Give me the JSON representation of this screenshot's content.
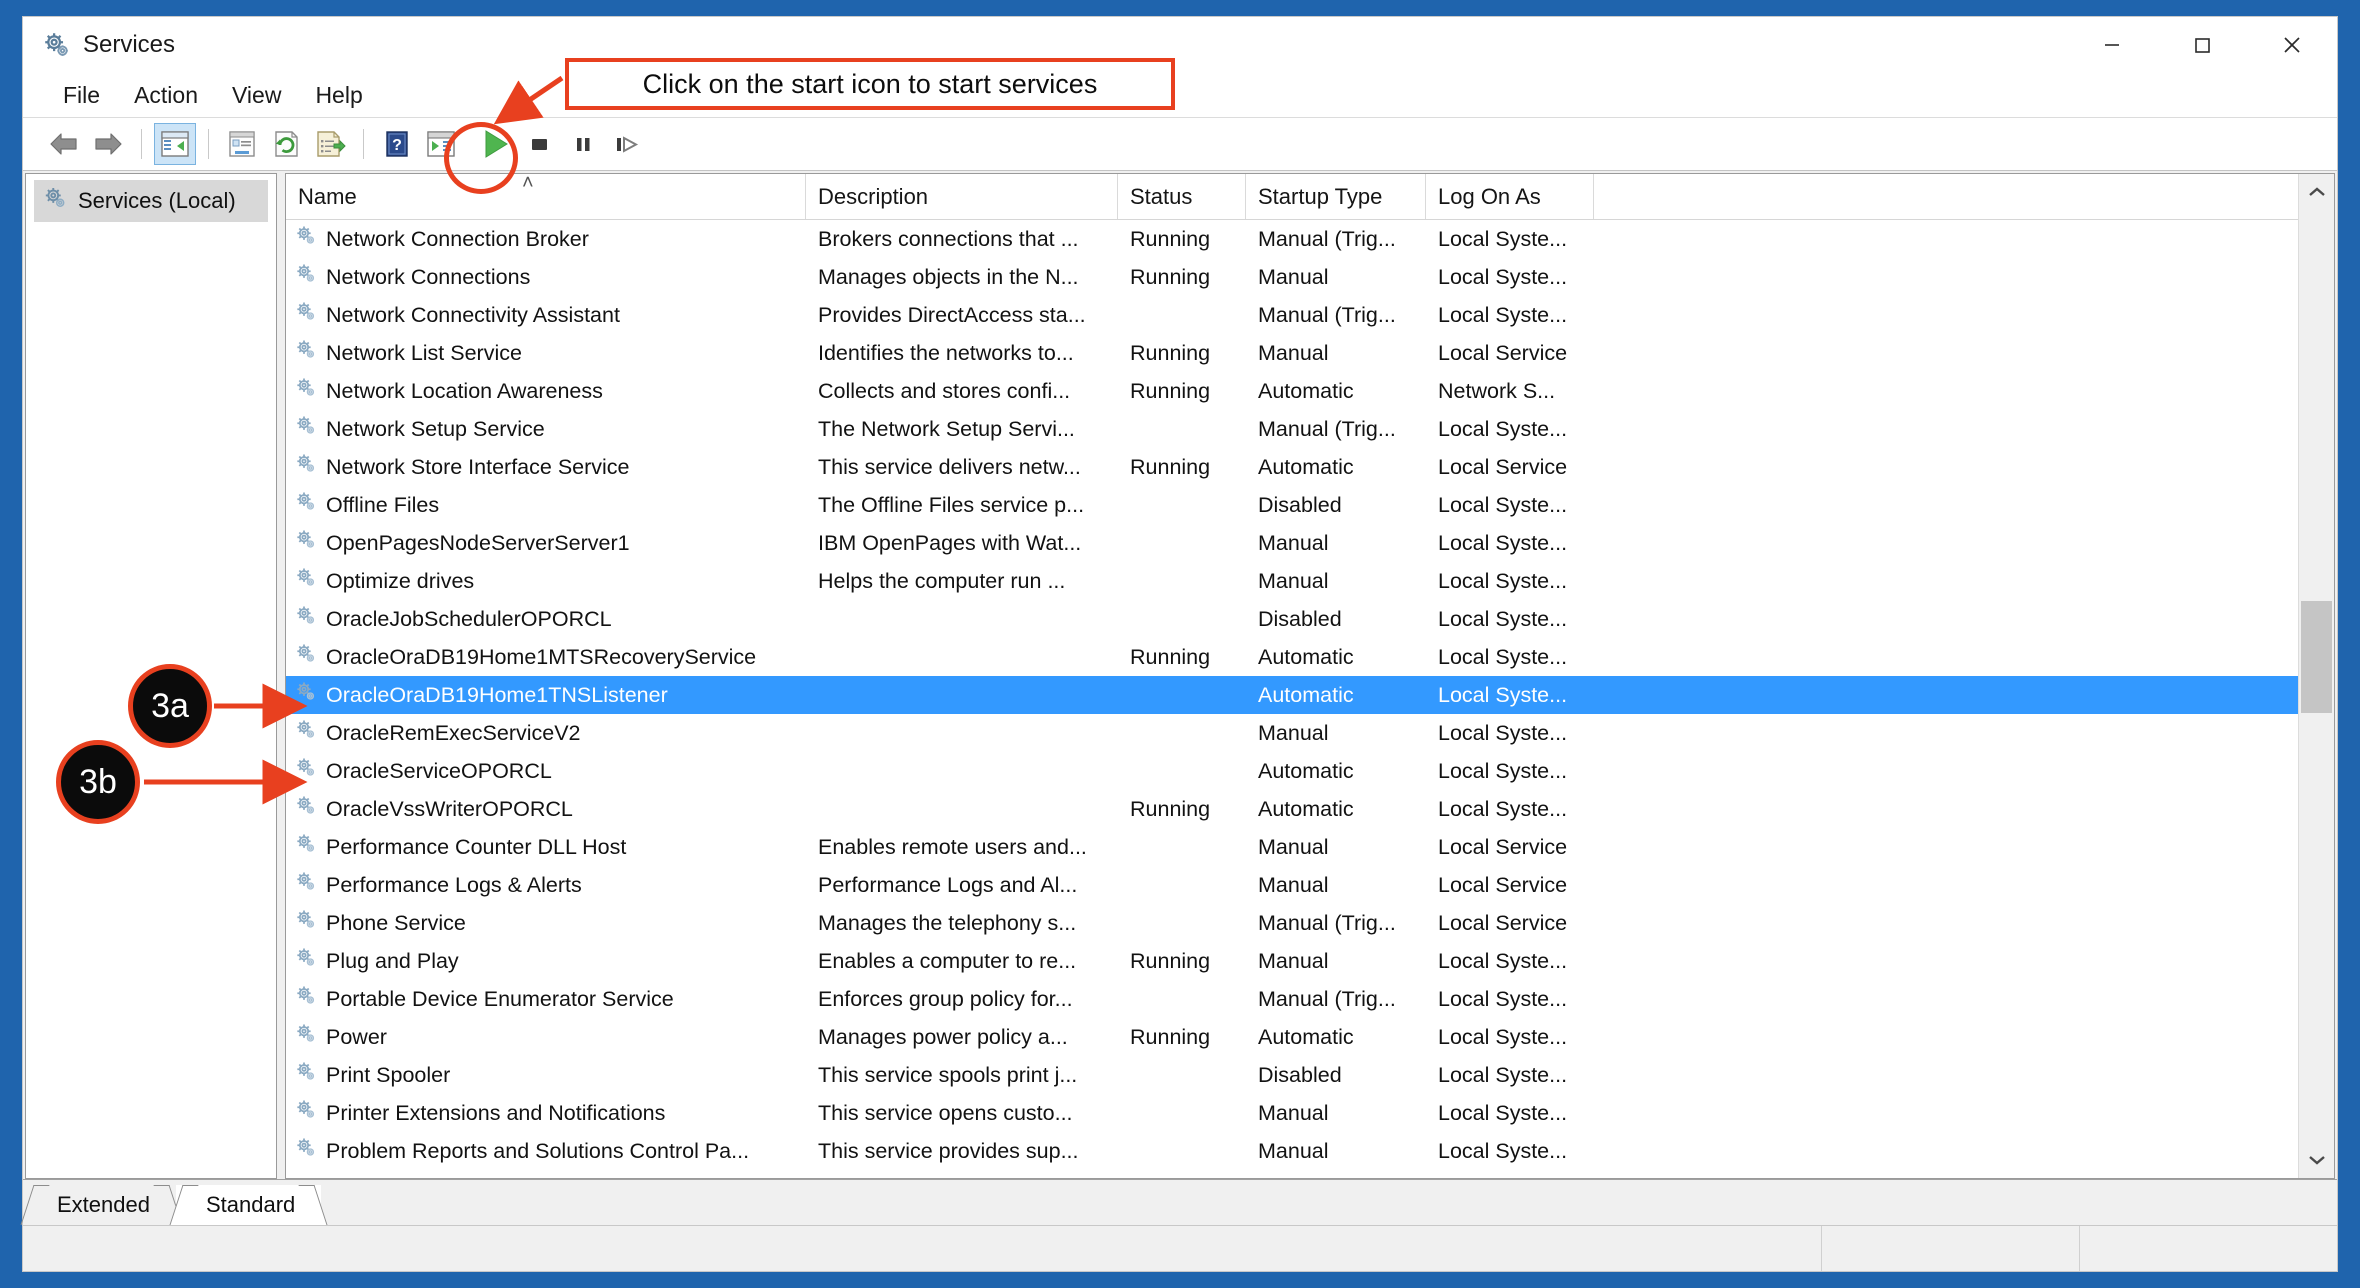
{
  "window": {
    "title": "Services",
    "icon": "services-gear-icon",
    "controls": {
      "minimize": "—",
      "maximize": "□",
      "close": "✕"
    }
  },
  "menu": {
    "items": [
      "File",
      "Action",
      "View",
      "Help"
    ]
  },
  "toolbar": {
    "icons": [
      "back-arrow-icon",
      "forward-arrow-icon",
      "show-hide-console-tree-icon",
      "properties-icon",
      "refresh-icon",
      "export-list-icon",
      "help-icon",
      "show-action-pane-icon",
      "start-service-icon",
      "stop-service-icon",
      "pause-service-icon",
      "restart-service-icon"
    ]
  },
  "tree": {
    "root_label": "Services (Local)",
    "root_icon": "services-gear-icon"
  },
  "list": {
    "columns": [
      "Name",
      "Description",
      "Status",
      "Startup Type",
      "Log On As"
    ],
    "sort_indicator": "˄",
    "rows": [
      {
        "name": "Network Connection Broker",
        "description": "Brokers connections that ...",
        "status": "Running",
        "startup": "Manual (Trig...",
        "logon": "Local Syste...",
        "selected": false
      },
      {
        "name": "Network Connections",
        "description": "Manages objects in the N...",
        "status": "Running",
        "startup": "Manual",
        "logon": "Local Syste...",
        "selected": false
      },
      {
        "name": "Network Connectivity Assistant",
        "description": "Provides DirectAccess sta...",
        "status": "",
        "startup": "Manual (Trig...",
        "logon": "Local Syste...",
        "selected": false
      },
      {
        "name": "Network List Service",
        "description": "Identifies the networks to...",
        "status": "Running",
        "startup": "Manual",
        "logon": "Local Service",
        "selected": false
      },
      {
        "name": "Network Location Awareness",
        "description": "Collects and stores confi...",
        "status": "Running",
        "startup": "Automatic",
        "logon": "Network S...",
        "selected": false
      },
      {
        "name": "Network Setup Service",
        "description": "The Network Setup Servi...",
        "status": "",
        "startup": "Manual (Trig...",
        "logon": "Local Syste...",
        "selected": false
      },
      {
        "name": "Network Store Interface Service",
        "description": "This service delivers netw...",
        "status": "Running",
        "startup": "Automatic",
        "logon": "Local Service",
        "selected": false
      },
      {
        "name": "Offline Files",
        "description": "The Offline Files service p...",
        "status": "",
        "startup": "Disabled",
        "logon": "Local Syste...",
        "selected": false
      },
      {
        "name": "OpenPagesNodeServerServer1",
        "description": "IBM OpenPages with Wat...",
        "status": "",
        "startup": "Manual",
        "logon": "Local Syste...",
        "selected": false
      },
      {
        "name": "Optimize drives",
        "description": "Helps the computer run ...",
        "status": "",
        "startup": "Manual",
        "logon": "Local Syste...",
        "selected": false
      },
      {
        "name": "OracleJobSchedulerOPORCL",
        "description": "",
        "status": "",
        "startup": "Disabled",
        "logon": "Local Syste...",
        "selected": false
      },
      {
        "name": "OracleOraDB19Home1MTSRecoveryService",
        "description": "",
        "status": "Running",
        "startup": "Automatic",
        "logon": "Local Syste...",
        "selected": false
      },
      {
        "name": "OracleOraDB19Home1TNSListener",
        "description": "",
        "status": "",
        "startup": "Automatic",
        "logon": "Local Syste...",
        "selected": true
      },
      {
        "name": "OracleRemExecServiceV2",
        "description": "",
        "status": "",
        "startup": "Manual",
        "logon": "Local Syste...",
        "selected": false
      },
      {
        "name": "OracleServiceOPORCL",
        "description": "",
        "status": "",
        "startup": "Automatic",
        "logon": "Local Syste...",
        "selected": false
      },
      {
        "name": "OracleVssWriterOPORCL",
        "description": "",
        "status": "Running",
        "startup": "Automatic",
        "logon": "Local Syste...",
        "selected": false
      },
      {
        "name": "Performance Counter DLL Host",
        "description": "Enables remote users and...",
        "status": "",
        "startup": "Manual",
        "logon": "Local Service",
        "selected": false
      },
      {
        "name": "Performance Logs & Alerts",
        "description": "Performance Logs and Al...",
        "status": "",
        "startup": "Manual",
        "logon": "Local Service",
        "selected": false
      },
      {
        "name": "Phone Service",
        "description": "Manages the telephony s...",
        "status": "",
        "startup": "Manual (Trig...",
        "logon": "Local Service",
        "selected": false
      },
      {
        "name": "Plug and Play",
        "description": "Enables a computer to re...",
        "status": "Running",
        "startup": "Manual",
        "logon": "Local Syste...",
        "selected": false
      },
      {
        "name": "Portable Device Enumerator Service",
        "description": "Enforces group policy for...",
        "status": "",
        "startup": "Manual (Trig...",
        "logon": "Local Syste...",
        "selected": false
      },
      {
        "name": "Power",
        "description": "Manages power policy a...",
        "status": "Running",
        "startup": "Automatic",
        "logon": "Local Syste...",
        "selected": false
      },
      {
        "name": "Print Spooler",
        "description": "This service spools print j...",
        "status": "",
        "startup": "Disabled",
        "logon": "Local Syste...",
        "selected": false
      },
      {
        "name": "Printer Extensions and Notifications",
        "description": "This service opens custo...",
        "status": "",
        "startup": "Manual",
        "logon": "Local Syste...",
        "selected": false
      },
      {
        "name": "Problem Reports and Solutions Control Pa...",
        "description": "This service provides sup...",
        "status": "",
        "startup": "Manual",
        "logon": "Local Syste...",
        "selected": false
      }
    ]
  },
  "tabs": [
    {
      "label": "Extended",
      "active": false
    },
    {
      "label": "Standard",
      "active": true
    }
  ],
  "annotations": {
    "callout_text": "Click on the start icon to start services",
    "badges": [
      {
        "label": "3a"
      },
      {
        "label": "3b"
      }
    ],
    "accent_color": "#e8401f",
    "badge_fill": "#0b0b0b"
  }
}
